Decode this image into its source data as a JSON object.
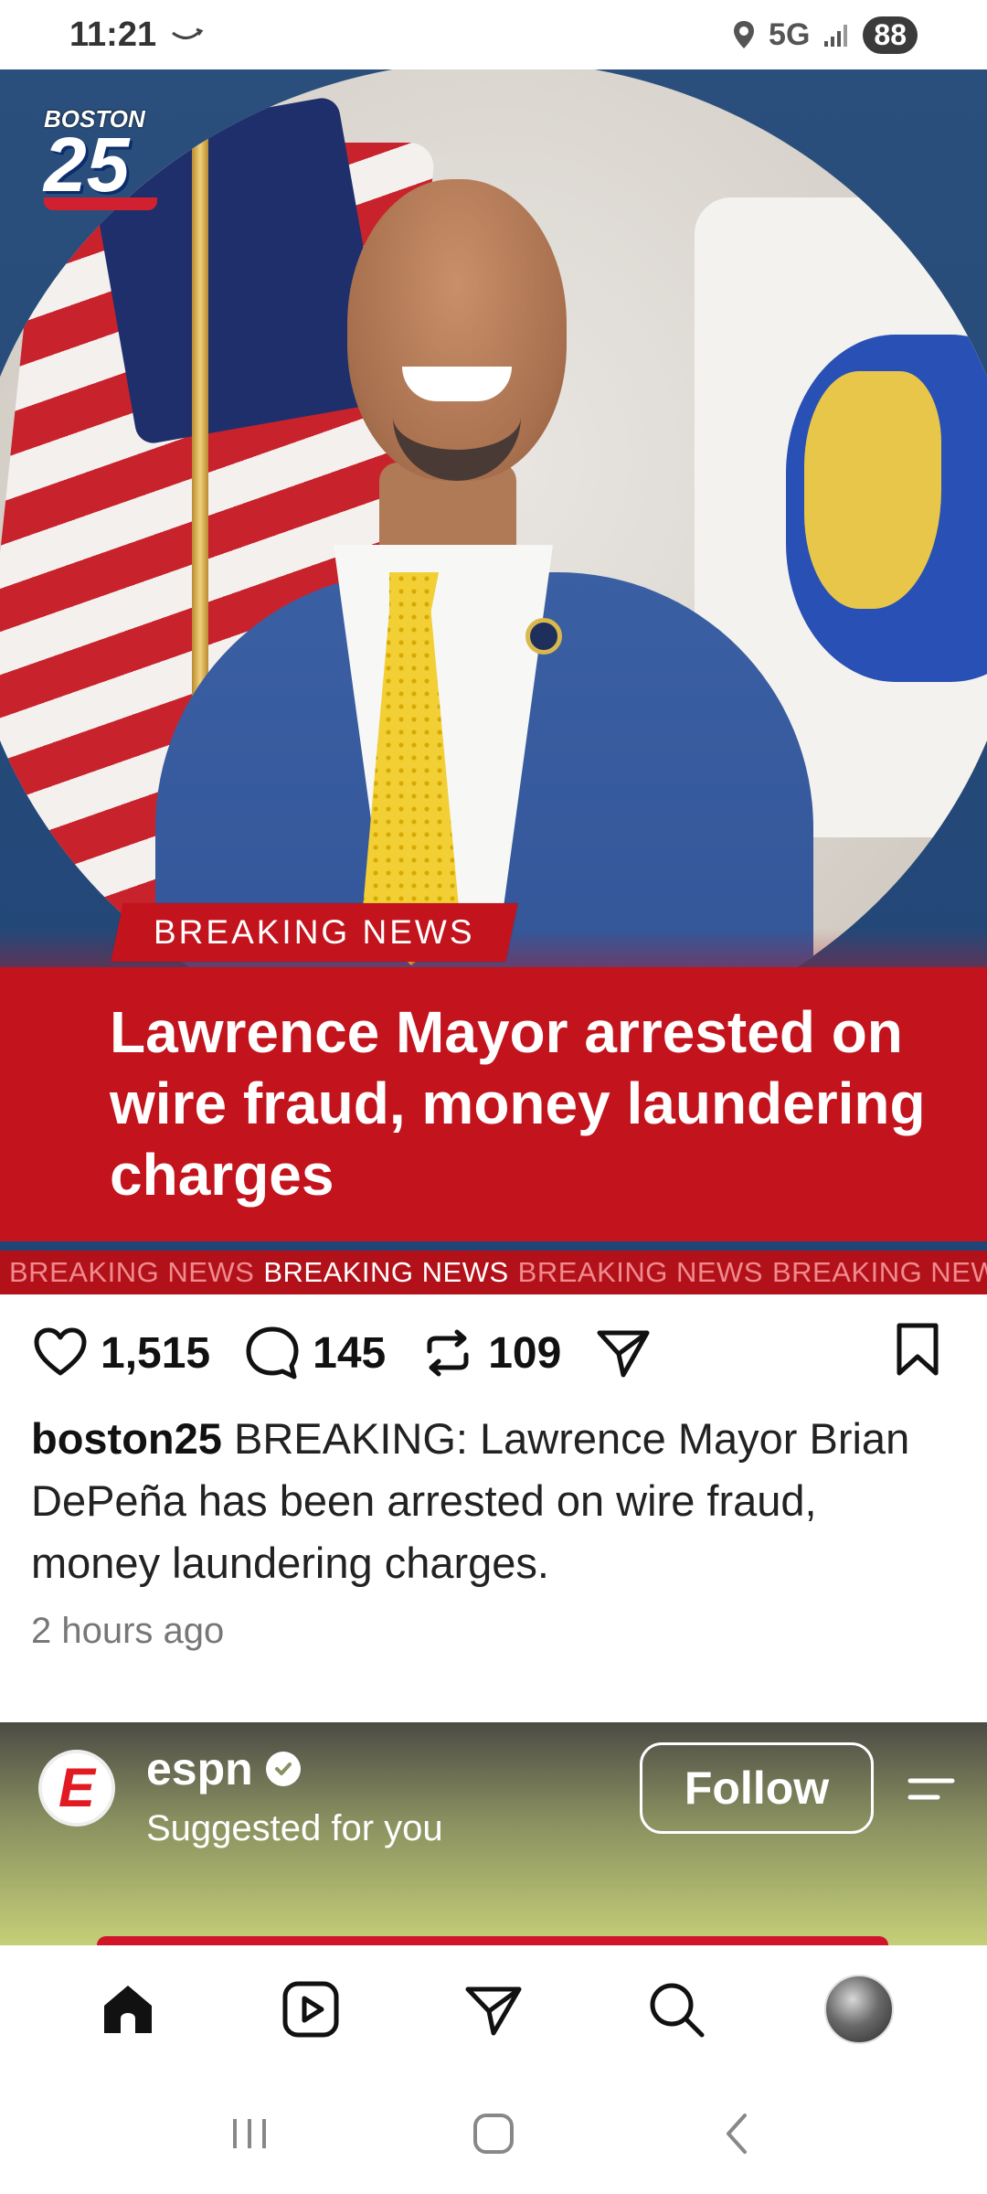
{
  "status_bar": {
    "time": "11:21",
    "network": "5G",
    "battery": "88"
  },
  "post": {
    "logo": {
      "top": "BOSTON",
      "number": "25"
    },
    "image_tag": "BREAKING NEWS",
    "headline": "Lawrence Mayor arrested on wire fraud, money laundering charges",
    "ticker": [
      "BREAKING NEWS",
      "BREAKING NEWS",
      "BREAKING NEWS",
      "BREAKING NEWS"
    ],
    "likes": "1,515",
    "comments": "145",
    "reposts": "109",
    "username": "boston25",
    "caption": "BREAKING: Lawrence Mayor Brian DePeña has been arrested on wire fraud, money laundering charges.",
    "time_ago": "2 hours ago"
  },
  "suggested": {
    "account": "espn",
    "avatar_letter": "E",
    "subtitle": "Suggested for you",
    "follow_label": "Follow"
  },
  "icons": {
    "like": "heart-icon",
    "comment": "comment-icon",
    "repost": "repost-icon",
    "share": "send-icon",
    "save": "bookmark-icon",
    "home": "home-icon",
    "reels": "reels-icon",
    "messages": "send-icon",
    "search": "search-icon",
    "profile": "avatar"
  },
  "colors": {
    "breaking_red": "#c3131d",
    "ticker_red": "#b3111a",
    "espn_red": "#e21b23"
  }
}
